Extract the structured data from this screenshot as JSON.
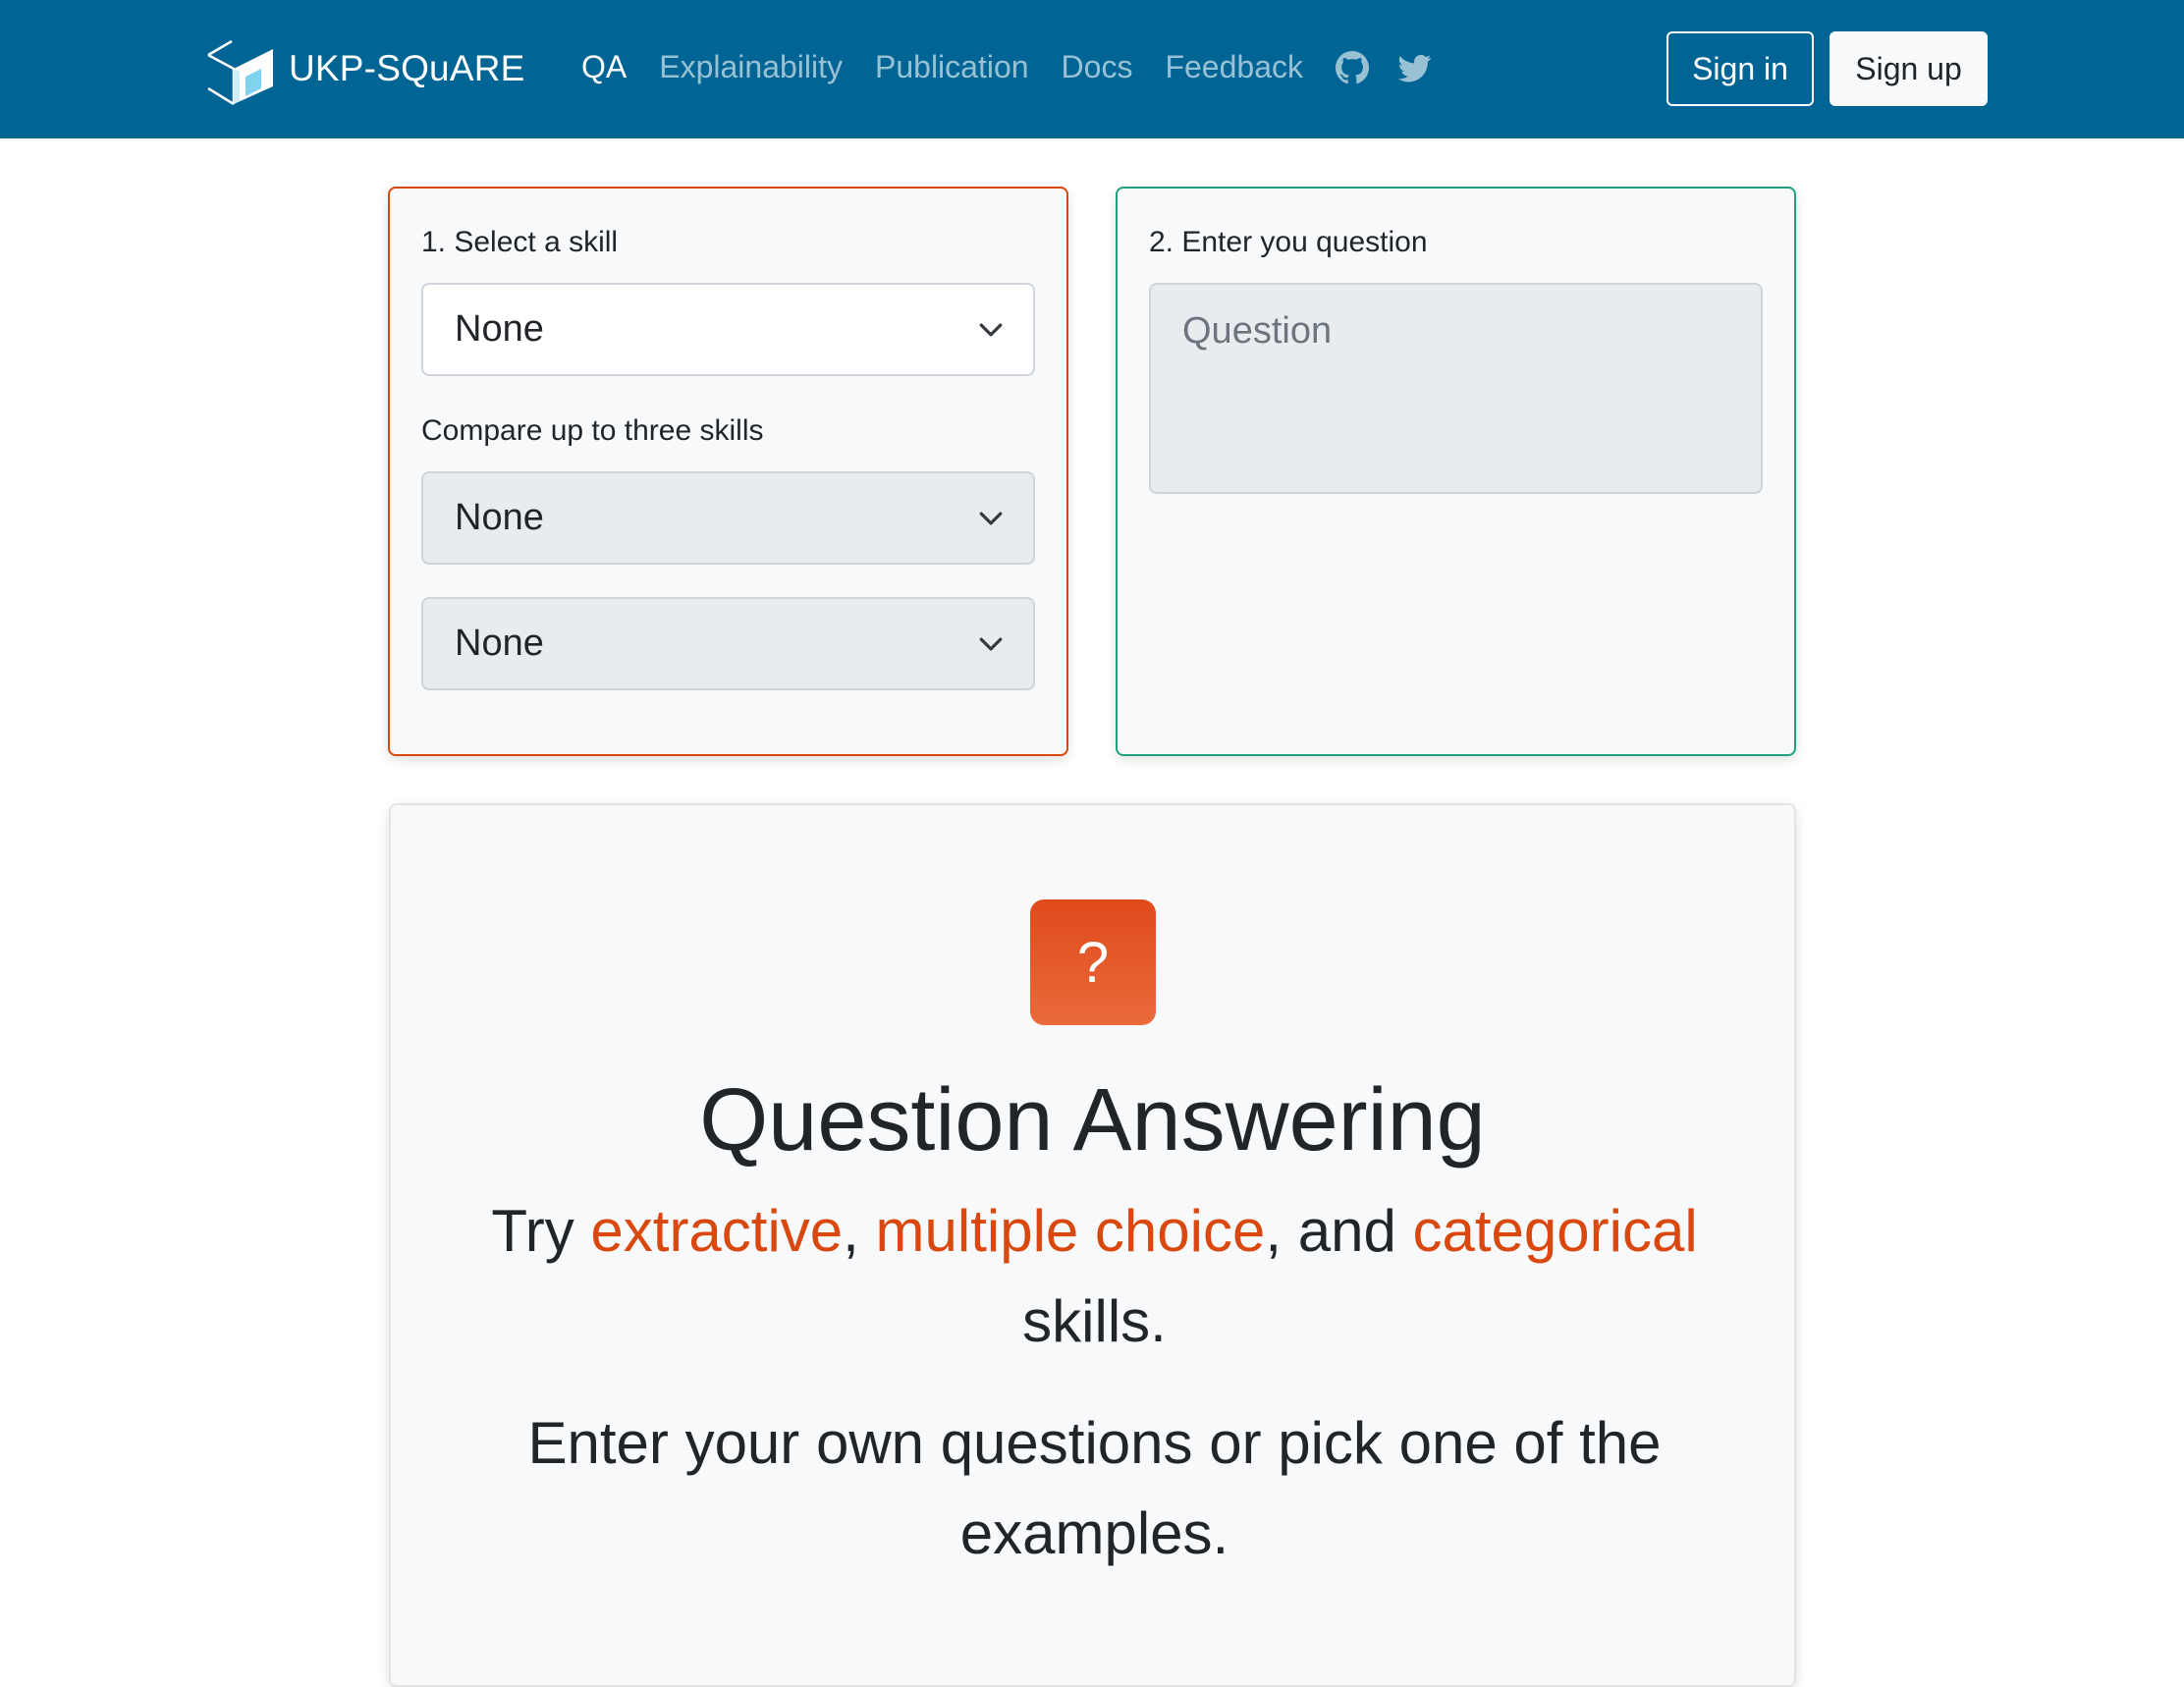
{
  "nav": {
    "brand": "UKP-SQuARE",
    "links": [
      "QA",
      "Explainability",
      "Publication",
      "Docs",
      "Feedback"
    ],
    "icons": [
      "github-icon",
      "twitter-icon"
    ],
    "sign_in": "Sign in",
    "sign_up": "Sign up"
  },
  "skill_card": {
    "label": "1. Select a skill",
    "primary_value": "None",
    "compare_label": "Compare up to three skills",
    "compare_values": [
      "None",
      "None"
    ]
  },
  "question_card": {
    "label": "2. Enter you question",
    "placeholder": "Question"
  },
  "hero": {
    "icon": "?",
    "title": "Question Answering",
    "try_prefix": "Try ",
    "skill_type_1": "extractive",
    "sep1": ", ",
    "skill_type_2": "multiple choice",
    "sep2": ", and ",
    "skill_type_3": "categorical",
    "try_suffix": " skills.",
    "line2": "Enter your own questions or pick one of the examples."
  },
  "colors": {
    "navbar": "#006494",
    "accent": "#d9480f",
    "question_border": "#20a17e"
  }
}
